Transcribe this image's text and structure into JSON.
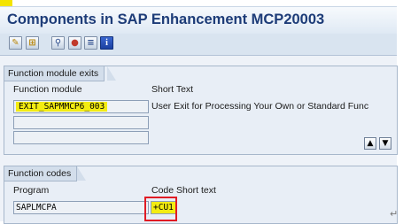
{
  "title_bar": {
    "title": "Components in SAP Enhancement MCP20003"
  },
  "toolbar": {
    "buttons": [
      {
        "icon": "edit-pencil-icon",
        "color": "#b8860b"
      },
      {
        "icon": "display-toggle-icon",
        "color": "#b8860b"
      },
      {
        "icon": "magnify-icon",
        "color": "#2f4f8f"
      },
      {
        "icon": "stop-icon",
        "color": "#c0392b"
      },
      {
        "icon": "list-icon",
        "color": "#2f4f8f"
      },
      {
        "icon": "info-icon",
        "color": "#1a3fa0"
      }
    ]
  },
  "function_module_exits": {
    "group_title": "Function module exits",
    "col_function_module": "Function module",
    "col_short_text": "Short Text",
    "rows": [
      {
        "module": "EXIT_SAPMMCP6_003",
        "short_text": "User Exit for Processing Your Own or Standard Func",
        "highlighted": true
      },
      {
        "module": "",
        "short_text": "",
        "highlighted": false
      },
      {
        "module": "",
        "short_text": "",
        "highlighted": false
      }
    ],
    "row_buttons": [
      {
        "icon": "page-up-icon"
      },
      {
        "icon": "page-down-icon"
      }
    ]
  },
  "function_codes": {
    "group_title": "Function codes",
    "col_program": "Program",
    "col_code": "Code",
    "col_short_text": "Short text",
    "rows": [
      {
        "program": "SAPLMCPA",
        "code": "+CU1",
        "short_text": "",
        "highlighted": true
      }
    ]
  },
  "colors": {
    "title": "#1d3c78",
    "highlight": "#f3ec12",
    "annotation_box": "#e01b24"
  }
}
